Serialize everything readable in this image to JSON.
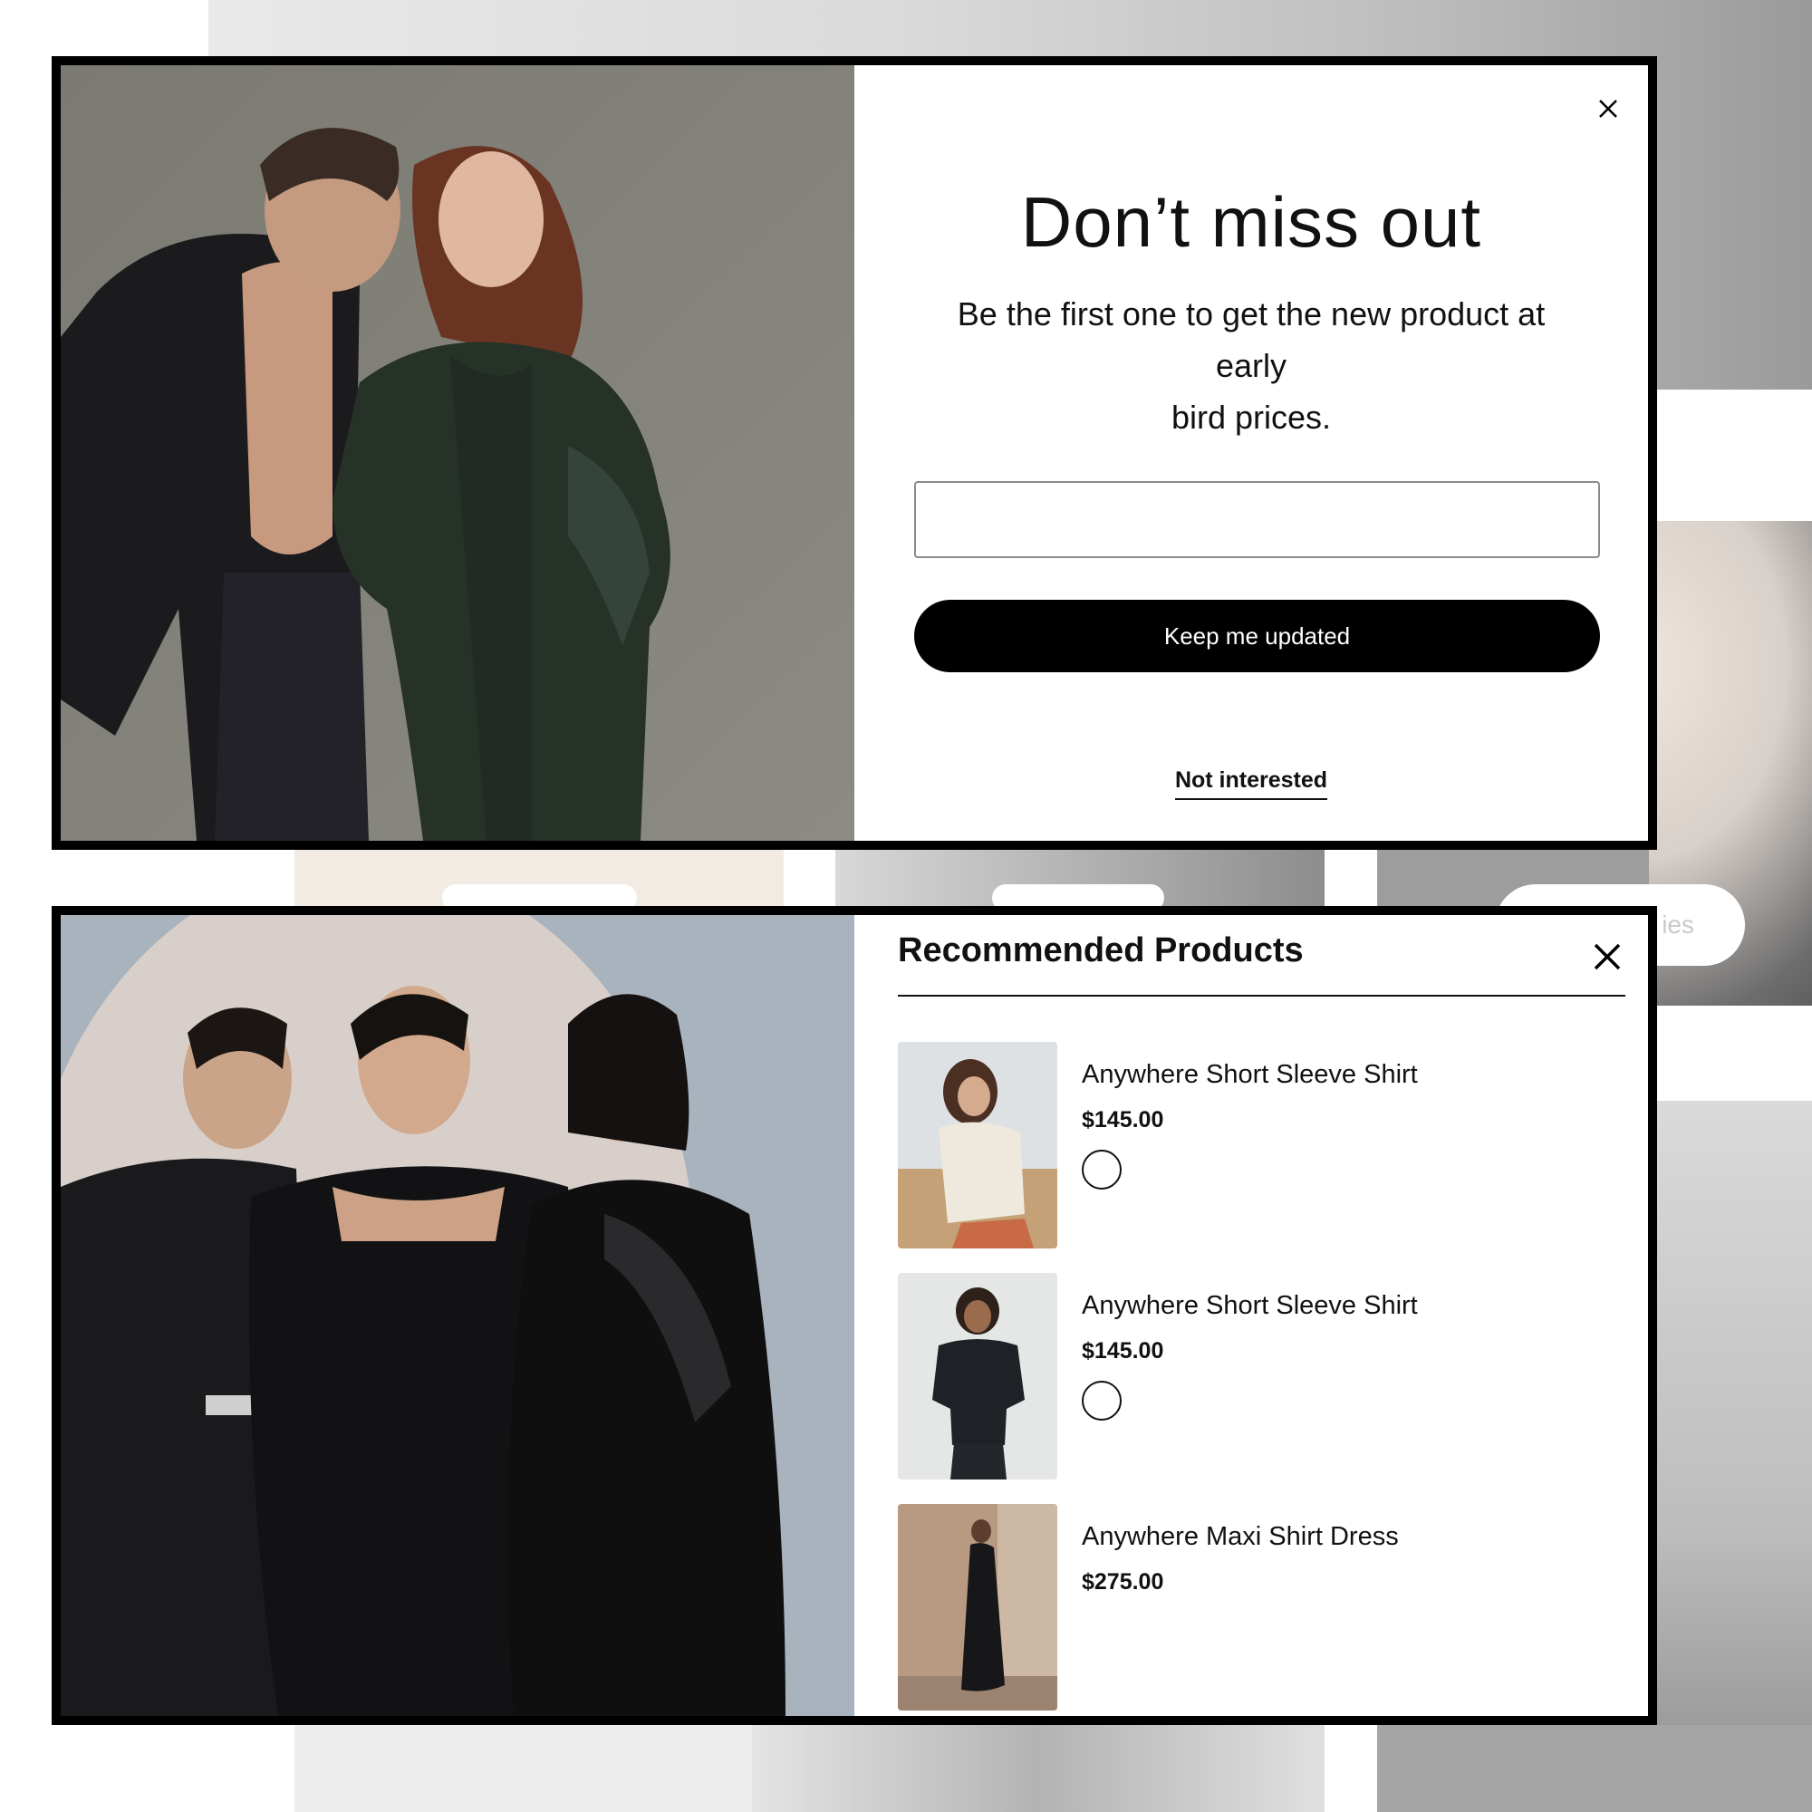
{
  "newsletter_popup": {
    "title": "Don’t miss out",
    "subtitle_lines": [
      "Be the first one to get the new product at",
      "early",
      "bird prices."
    ],
    "email_input": {
      "value": "",
      "placeholder": ""
    },
    "submit_label": "Keep me updated",
    "decline_label": "Not interested",
    "close_icon": "close-icon"
  },
  "recommended_popup": {
    "title": "Recommended Products",
    "close_icon": "close-icon",
    "products": [
      {
        "name": "Anywhere Short Sleeve Shirt",
        "price": "$145.00",
        "has_swatch": true
      },
      {
        "name": "Anywhere Short Sleeve Shirt",
        "price": "$145.00",
        "has_swatch": true
      },
      {
        "name": "Anywhere Maxi Shirt Dress",
        "price": "$275.00",
        "has_swatch": false
      }
    ]
  },
  "background_page": {
    "partial_button_text": "ies"
  },
  "colors": {
    "frame": "#000000",
    "button_bg": "#000000",
    "button_text": "#ffffff",
    "text": "#111111",
    "input_border": "#8a8a8a"
  }
}
